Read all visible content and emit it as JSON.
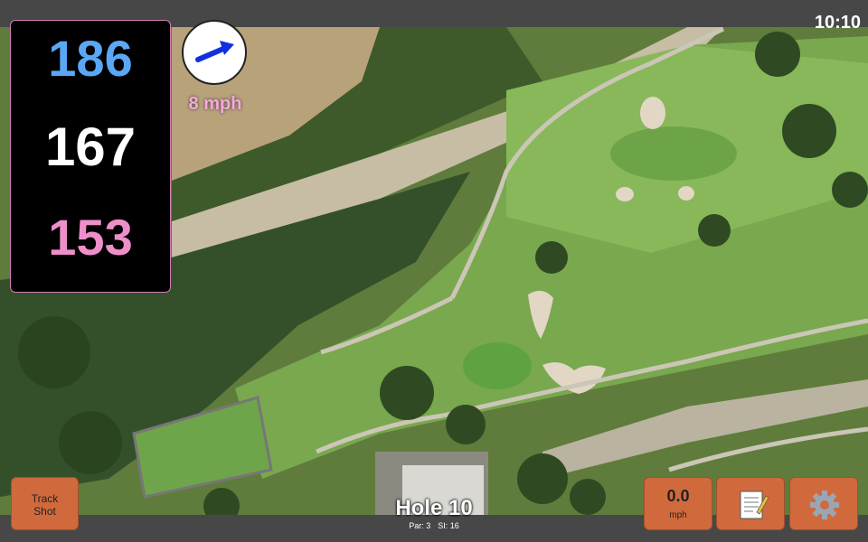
{
  "status": {
    "time": "10:10"
  },
  "distances": {
    "back": "186",
    "middle": "167",
    "front": "153"
  },
  "wind": {
    "speed": "8 mph",
    "icon": "wind-arrow-icon"
  },
  "hole": {
    "title": "Hole 10",
    "par": "Par: 3",
    "si": "SI: 16"
  },
  "buttons": {
    "track_shot": [
      "Track",
      "Shot"
    ],
    "speed_value": "0.0",
    "speed_unit": "mph",
    "notes_icon": "notes-icon",
    "settings_icon": "gear-icon"
  },
  "colors": {
    "back": "#5aa8f5",
    "middle": "#ffffff",
    "front": "#ef8fca",
    "button": "#d06a3d",
    "wind_arrow": "#1030e0"
  }
}
